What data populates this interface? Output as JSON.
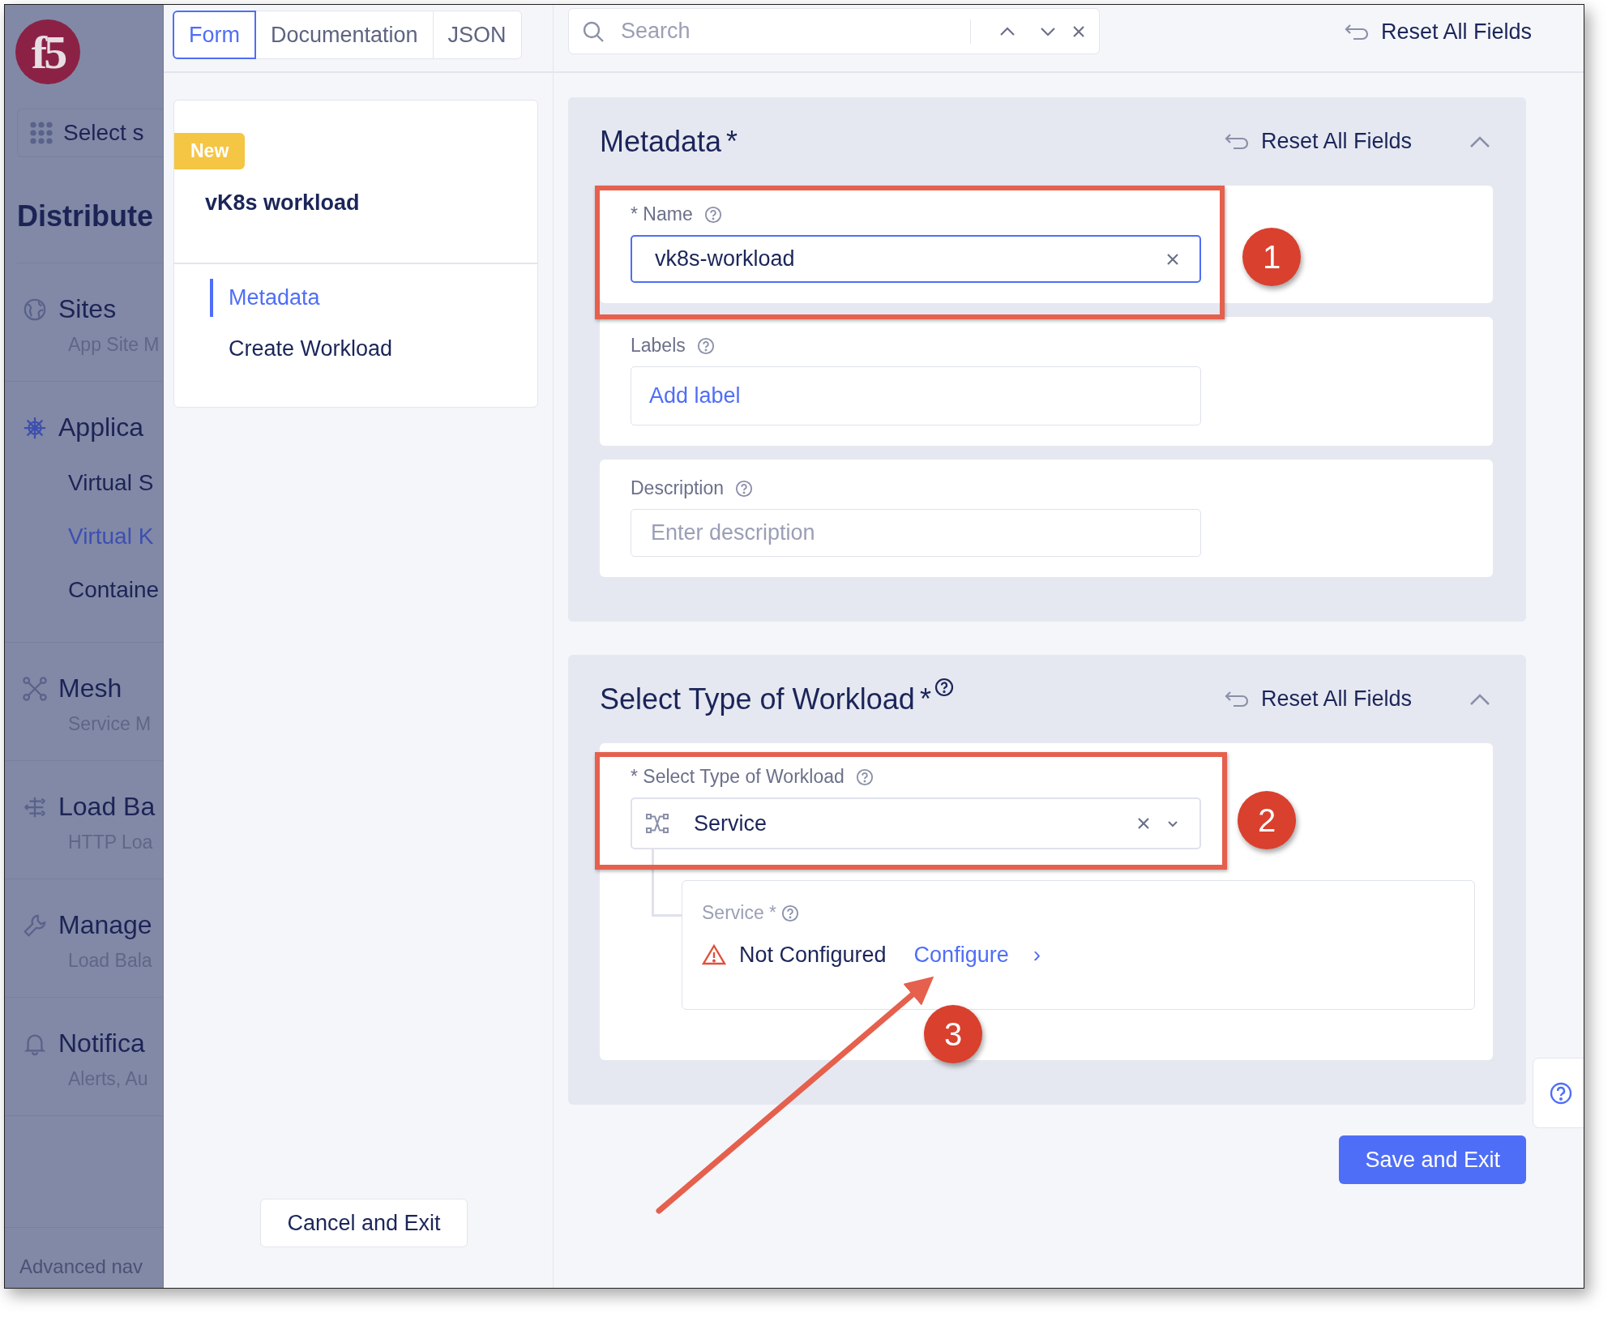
{
  "sidebar": {
    "logo": "f5",
    "workspace_select": "Select s",
    "title": "Distribute",
    "groups": [
      {
        "title": "Sites",
        "subtitle": "App Site M"
      },
      {
        "title": "Applica",
        "items": [
          {
            "label": "Virtual S",
            "selected": false
          },
          {
            "label": "Virtual K",
            "selected": true
          },
          {
            "label": "Containe",
            "selected": false
          }
        ]
      },
      {
        "title": "Mesh",
        "subtitle": "Service M"
      },
      {
        "title": "Load Ba",
        "subtitle": "HTTP Loa"
      },
      {
        "title": "Manage",
        "subtitle": "Load Bala"
      },
      {
        "title": "Notifica",
        "subtitle": "Alerts, Au"
      }
    ],
    "footer": "Advanced nav"
  },
  "tabs": [
    {
      "label": "Form",
      "selected": true
    },
    {
      "label": "Documentation",
      "selected": false
    },
    {
      "label": "JSON",
      "selected": false
    }
  ],
  "form_nav": {
    "badge": "New",
    "title": "vK8s workload",
    "items": [
      {
        "label": "Metadata",
        "selected": true
      },
      {
        "label": "Create Workload",
        "selected": false
      }
    ]
  },
  "cancel_button": "Cancel and Exit",
  "search": {
    "placeholder": "Search"
  },
  "reset_all": "Reset All Fields",
  "sections": [
    {
      "title": "Metadata",
      "mark": "*",
      "help": false,
      "reset": "Reset All Fields",
      "fields": [
        {
          "kind": "text",
          "label": "* Name",
          "value": "vk8s-workload"
        },
        {
          "kind": "labels",
          "label": "Labels",
          "action": "Add label"
        },
        {
          "kind": "textarea",
          "label": "Description",
          "placeholder": "Enter description"
        }
      ]
    },
    {
      "title": "Select Type of Workload",
      "mark": "*",
      "help": true,
      "reset": "Reset All Fields",
      "fields": [
        {
          "kind": "select",
          "label": "* Select Type of Workload",
          "value": "Service",
          "child": {
            "label": "Service *",
            "status": "Not Configured",
            "action": "Configure",
            "chevron": "›"
          }
        }
      ]
    }
  ],
  "save_button": "Save and Exit",
  "annotations": [
    {
      "kind": "box",
      "number": "1"
    },
    {
      "kind": "box",
      "number": "2"
    },
    {
      "kind": "arrow",
      "number": "3"
    }
  ]
}
